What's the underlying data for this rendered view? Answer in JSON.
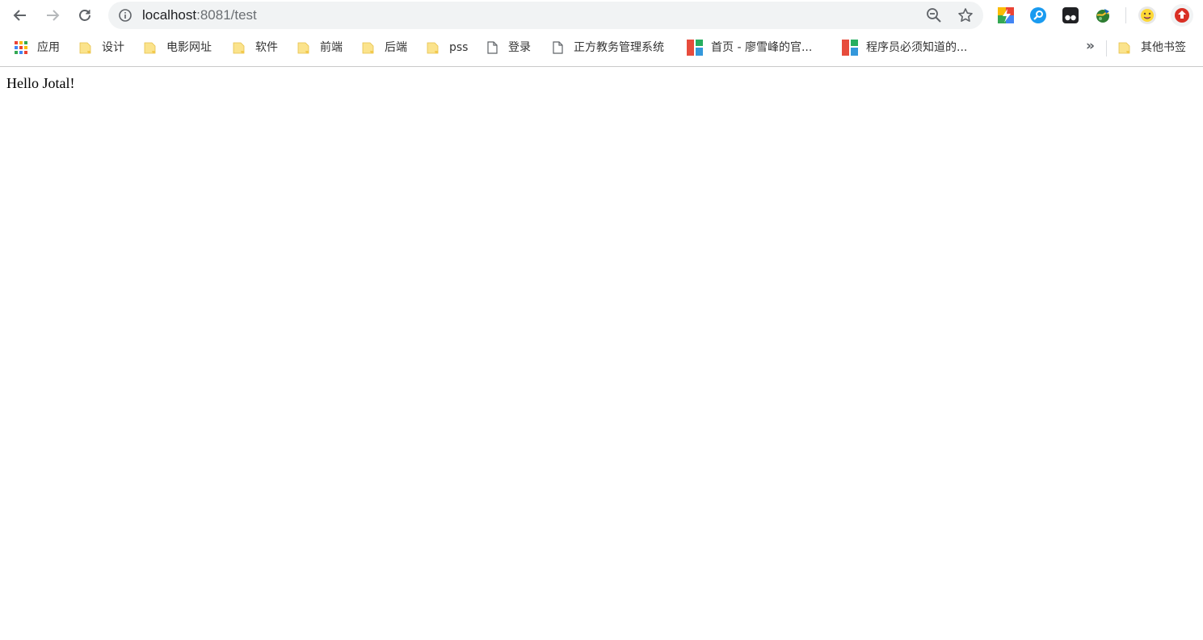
{
  "toolbar": {
    "url_host": "localhost",
    "url_rest": ":8081/test"
  },
  "bookmarks": {
    "items": [
      {
        "label": "应用",
        "icon": "apps-grid-icon"
      },
      {
        "label": "设计",
        "icon": "folder-icon"
      },
      {
        "label": "电影网址",
        "icon": "folder-icon"
      },
      {
        "label": "软件",
        "icon": "folder-icon"
      },
      {
        "label": "前端",
        "icon": "folder-icon"
      },
      {
        "label": "后端",
        "icon": "folder-icon"
      },
      {
        "label": "pss",
        "icon": "folder-icon"
      },
      {
        "label": "登录",
        "icon": "page-icon"
      },
      {
        "label": "正方教务管理系统",
        "icon": "page-icon"
      },
      {
        "label": "首页 - 廖雪峰的官...",
        "icon": "site-logo-icon"
      },
      {
        "label": "程序员必须知道的...",
        "icon": "site-logo-icon"
      }
    ],
    "overflow": "»",
    "other": "其他书签"
  },
  "page": {
    "body_text": "Hello Jotal!"
  },
  "colors": {
    "omnibox_bg": "#f1f3f4",
    "folder_yellow": "#fbe38c",
    "accent_blue": "#1a73e8",
    "record_red": "#d93025"
  }
}
